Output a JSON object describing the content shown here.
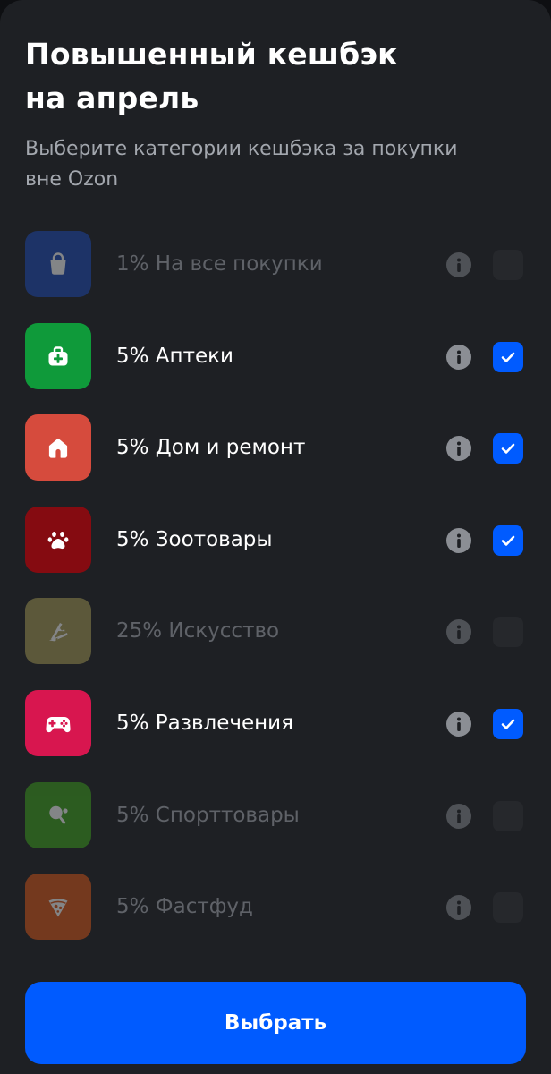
{
  "header": {
    "title_line1": "Повышенный кешбэк",
    "title_line2": "на апрель",
    "subtitle_line1": "Выберите категории кешбэка за покупки",
    "subtitle_line2": "вне Ozon"
  },
  "categories": [
    {
      "label": "1% На все покупки",
      "icon": "shopping-bag-icon",
      "color": "#1c4bb8",
      "checked": false,
      "disabled": true
    },
    {
      "label": "5% Аптеки",
      "icon": "first-aid-kit-icon",
      "color": "#0f9a3a",
      "checked": true,
      "disabled": false
    },
    {
      "label": "5% Дом и ремонт",
      "icon": "house-icon",
      "color": "#d64b3d",
      "checked": true,
      "disabled": false
    },
    {
      "label": "5% Зоотовары",
      "icon": "paw-icon",
      "color": "#850b11",
      "checked": true,
      "disabled": false
    },
    {
      "label": "25% Искусство",
      "icon": "art-supplies-icon",
      "color": "#a79d55",
      "checked": false,
      "disabled": true
    },
    {
      "label": "5% Развлечения",
      "icon": "gamepad-icon",
      "color": "#d8164f",
      "checked": true,
      "disabled": false
    },
    {
      "label": "5% Спорттовары",
      "icon": "ping-pong-icon",
      "color": "#3fa51d",
      "checked": false,
      "disabled": true
    },
    {
      "label": "5% Фастфуд",
      "icon": "pizza-slice-icon",
      "color": "#dc5818",
      "checked": false,
      "disabled": true
    }
  ],
  "footer": {
    "submit_label": "Выбрать"
  },
  "colors": {
    "accent": "#005bff",
    "background": "#1e2024"
  }
}
